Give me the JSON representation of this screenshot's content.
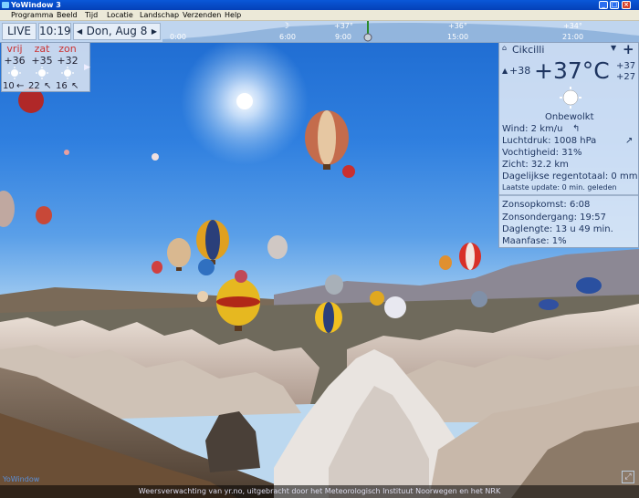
{
  "window": {
    "title": "YoWindow 3"
  },
  "menu": [
    "Programma",
    "Beeld",
    "Tijd",
    "Locatie",
    "Landschap",
    "Verzenden",
    "Help"
  ],
  "topbar": {
    "live": "LIVE",
    "time": "10:19",
    "date": "Don, Aug 8",
    "prev": "◀",
    "next": "▶",
    "timeline": {
      "temps": [
        "+37°",
        "+36°",
        "+34°"
      ],
      "times": [
        "0:00",
        "6:00",
        "9:00",
        "15:00",
        "21:00"
      ]
    }
  },
  "forecast": {
    "days": [
      {
        "name": "vrij",
        "temp": "+36"
      },
      {
        "name": "zat",
        "temp": "+35"
      },
      {
        "name": "zon",
        "temp": "+32"
      }
    ],
    "bottom": [
      "10",
      "←",
      "22",
      "↖",
      "16",
      "↖"
    ]
  },
  "current": {
    "location": "Cikcilli",
    "add": "+",
    "feels": "+38",
    "temp": "+37°C",
    "high": "+37",
    "low": "+27",
    "condition": "Onbewolkt",
    "wind": "Wind:  2 km/u",
    "pressure": "Luchtdruk:  1008 hPa",
    "humidity": "Vochtigheid:  31%",
    "visibility": "Zicht:  32.2 km",
    "rain": "Dagelijkse regentotaal:  0 mm",
    "update": "Laatste update:  0 min. geleden",
    "sunrise": "Zonsopkomst:  6:08",
    "sunset": "Zonsondergang:  19:57",
    "daylength": "Daglengte:  13 u 49 min.",
    "moon": "Maanfase:  1%"
  },
  "status": {
    "credit": "Weersverwachting van yr.no, uitgebracht door het Meteorologisch Instituut Noorwegen en het NRK",
    "brand": "YoWindow",
    "fullscreen": "⤢"
  },
  "icons": {
    "sun": "sun-icon",
    "moon": "moon-icon",
    "home": "home-icon",
    "wind_arrow": "wind-arrow-icon",
    "pressure_arrow": "pressure-trend-icon"
  }
}
